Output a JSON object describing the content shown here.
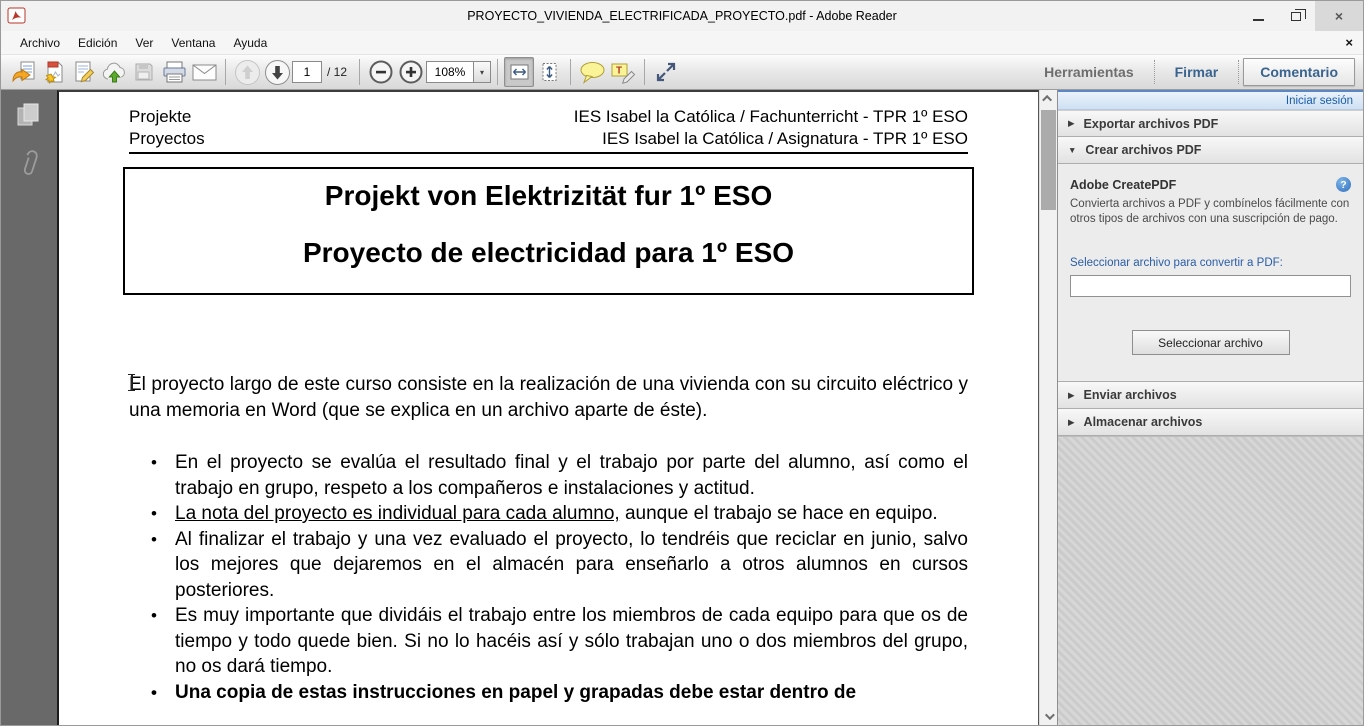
{
  "window": {
    "title": "PROYECTO_VIVIENDA_ELECTRIFICADA_PROYECTO.pdf - Adobe Reader"
  },
  "menu": {
    "items": [
      "Archivo",
      "Edición",
      "Ver",
      "Ventana",
      "Ayuda"
    ],
    "close_label": "×"
  },
  "toolbar": {
    "page_current": "1",
    "page_total": "/ 12",
    "zoom_level": "108%",
    "zoom_drop_arrow": "▾",
    "tabs": [
      {
        "label": "Herramientas"
      },
      {
        "label": "Firmar"
      },
      {
        "label": "Comentario"
      }
    ]
  },
  "panel": {
    "sign_in": "Iniciar sesión",
    "sections": [
      {
        "arrow": "▶",
        "label": "Exportar archivos PDF"
      },
      {
        "arrow": "▼",
        "label": "Crear archivos PDF"
      },
      {
        "arrow": "▶",
        "label": "Enviar archivos"
      },
      {
        "arrow": "▶",
        "label": "Almacenar archivos"
      }
    ],
    "create_pdf": {
      "title": "Adobe CreatePDF",
      "help_label": "?",
      "description": "Convierta archivos a PDF y combínelos fácilmente con otros tipos de archivos con una suscripción de pago.",
      "select_label": "Seleccionar archivo para convertir a PDF:",
      "input_value": "",
      "button_label": "Seleccionar archivo"
    }
  },
  "doc": {
    "header": {
      "left1": "Projekte",
      "left2": "Proyectos",
      "right1": "IES Isabel la Católica / Fachunterricht - TPR 1º ESO",
      "right2": "IES Isabel la Católica / Asignatura - TPR 1º ESO"
    },
    "title1": "Projekt von Elektrizität fur 1º ESO",
    "title2": "Proyecto de electricidad para 1º ESO",
    "intro": "El proyecto largo de este curso consiste en la realización de una vivienda con su circuito eléctrico y una  memoria en Word (que se explica en un archivo aparte de éste).",
    "bullets": [
      {
        "text": "En el proyecto se evalúa el resultado final y el trabajo por parte del alumno, así como el trabajo en grupo, respeto a los compañeros e instalaciones y actitud."
      },
      {
        "underlined": "La nota del proyecto es individual para cada alumno,",
        "rest": " aunque el trabajo se hace en equipo."
      },
      {
        "text": "Al finalizar el trabajo y una vez evaluado el proyecto, lo tendréis que reciclar en junio, salvo los mejores que dejaremos en el almacén para enseñarlo a otros alumnos en cursos posteriores."
      },
      {
        "text": "Es muy importante que dividáis el trabajo entre los miembros de cada equipo para que os de tiempo y todo quede bien. Si no lo hacéis así y sólo trabajan uno o dos miembros del grupo, no os dará tiempo."
      },
      {
        "text": "Una copia de estas instrucciones en papel y grapadas debe estar dentro de"
      }
    ]
  },
  "icons": {
    "window": [
      "minimize-icon",
      "restore-icon",
      "close-icon"
    ],
    "toolbar": [
      "open-icon",
      "create-pdf-icon",
      "sign-document-icon",
      "cloud-upload-icon",
      "save-icon",
      "print-icon",
      "email-icon",
      "previous-page-icon",
      "next-page-icon",
      "zoom-out-icon",
      "zoom-in-icon",
      "fit-width-icon",
      "fit-page-icon",
      "comment-bubble-icon",
      "text-annotation-icon",
      "fullscreen-icon"
    ],
    "left_rail": [
      "page-thumbnails-icon",
      "attachments-icon"
    ],
    "panel": [
      "help-icon",
      "section-expand-arrows"
    ]
  }
}
